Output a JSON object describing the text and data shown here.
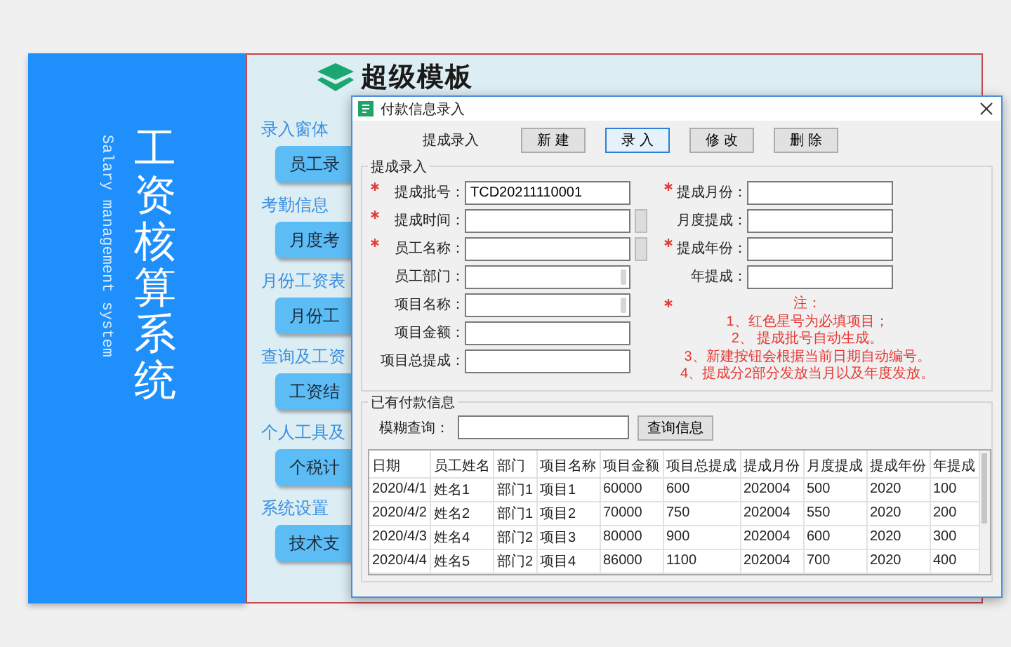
{
  "sidebar": {
    "title": "工资核算系统",
    "subtitle": "Salary management system"
  },
  "logo": {
    "text": "超级模板"
  },
  "nav": [
    {
      "label": "录入窗体",
      "button": "员工录"
    },
    {
      "label": "考勤信息",
      "button": "月度考"
    },
    {
      "label": "月份工资表",
      "button": "月份工"
    },
    {
      "label": "查询及工资",
      "button": "工资结"
    },
    {
      "label": "个人工具及",
      "button": "个税计"
    },
    {
      "label": "系统设置",
      "button": "技术支"
    }
  ],
  "dialog": {
    "title": "付款信息录入",
    "toolbar": {
      "label": "提成录入",
      "buttons": [
        {
          "label": "新 建",
          "selected": false
        },
        {
          "label": "录 入",
          "selected": true
        },
        {
          "label": "修 改",
          "selected": false
        },
        {
          "label": "删 除",
          "selected": false
        }
      ]
    },
    "entry_group": {
      "title": "提成录入",
      "left_fields": [
        {
          "label": "提成批号：",
          "required": true,
          "kind": "text",
          "value": "TCD20211110001"
        },
        {
          "label": "提成时间：",
          "required": true,
          "kind": "picker"
        },
        {
          "label": "员工名称：",
          "required": true,
          "kind": "picker"
        },
        {
          "label": "员工部门：",
          "required": false,
          "kind": "combo"
        },
        {
          "label": "项目名称：",
          "required": false,
          "kind": "combo"
        },
        {
          "label": "项目金额：",
          "required": false,
          "kind": "text"
        },
        {
          "label": "项目总提成：",
          "required": false,
          "kind": "text"
        }
      ],
      "right_fields": [
        {
          "label": "提成月份：",
          "required": true,
          "kind": "text"
        },
        {
          "label": "月度提成：",
          "required": false,
          "kind": "text"
        },
        {
          "label": "提成年份：",
          "required": true,
          "kind": "text"
        },
        {
          "label": "年提成：",
          "required": false,
          "kind": "text"
        }
      ],
      "note": {
        "required": true,
        "lines": [
          "注：",
          "1、红色星号为必填项目；",
          "2、 提成批号自动生成。",
          "3、新建按钮会根据当前日期自动编号。",
          "4、提成分2部分发放当月以及年度发放。"
        ]
      }
    },
    "records_group": {
      "title": "已有付款信息",
      "search": {
        "label": "模糊查询：",
        "button": "查询信息"
      },
      "table": {
        "columns": [
          "日期",
          "员工姓名",
          "部门",
          "项目名称",
          "项目金额",
          "项目总提成",
          "提成月份",
          "月度提成",
          "提成年份",
          "年提成"
        ],
        "rows": [
          [
            "2020/4/1",
            "姓名1",
            "部门1",
            "项目1",
            "60000",
            "600",
            "202004",
            "500",
            "2020",
            "100"
          ],
          [
            "2020/4/2",
            "姓名2",
            "部门1",
            "项目2",
            "70000",
            "750",
            "202004",
            "550",
            "2020",
            "200"
          ],
          [
            "2020/4/3",
            "姓名4",
            "部门2",
            "项目3",
            "80000",
            "900",
            "202004",
            "600",
            "2020",
            "300"
          ],
          [
            "2020/4/4",
            "姓名5",
            "部门2",
            "项目4",
            "86000",
            "1100",
            "202004",
            "700",
            "2020",
            "400"
          ]
        ]
      }
    }
  }
}
